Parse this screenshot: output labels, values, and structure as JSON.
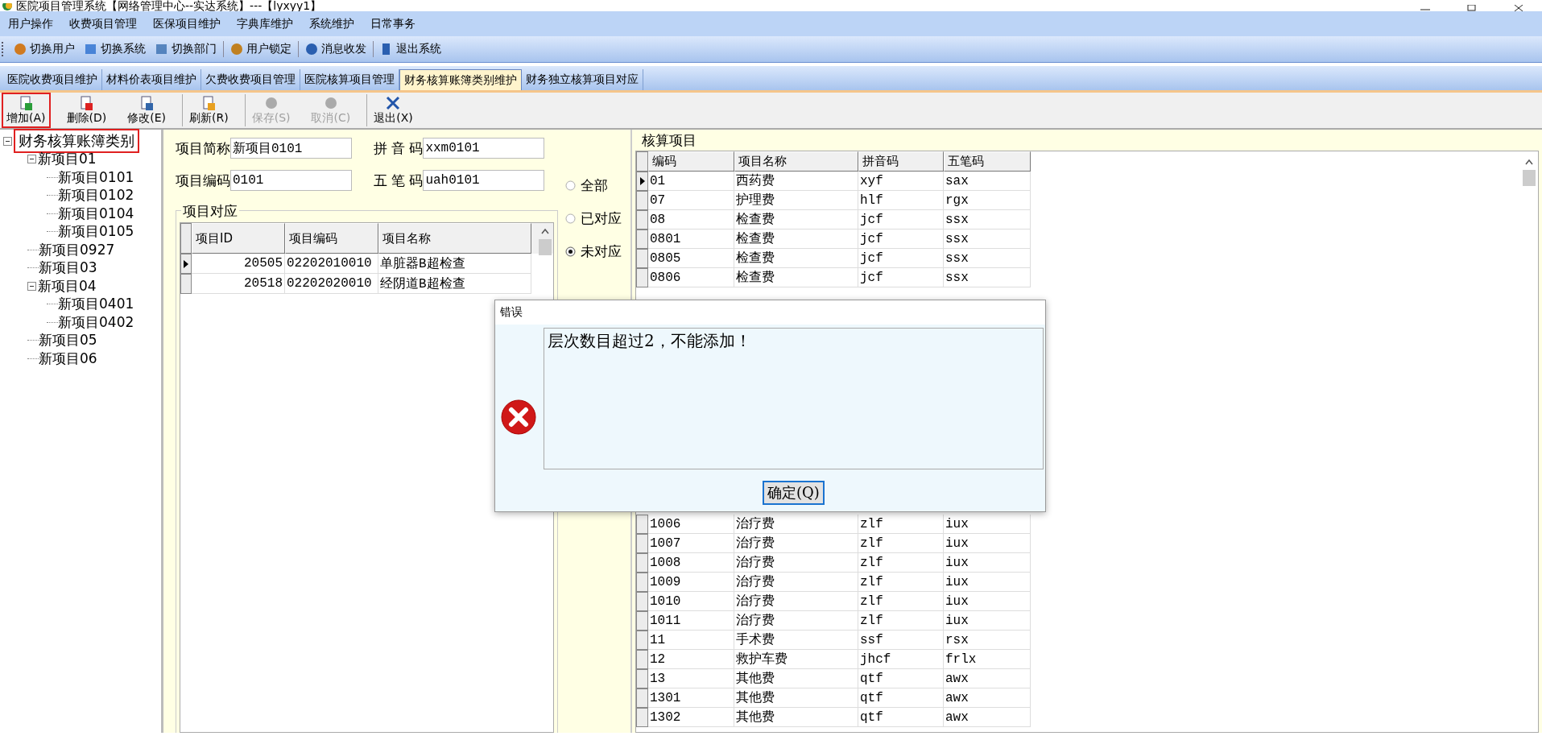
{
  "window": {
    "title": "医院项目管理系统【网络管理中心--实达系统】---【lyxyy1】"
  },
  "menu": [
    "用户操作",
    "收费项目管理",
    "医保项目维护",
    "字典库维护",
    "系统维护",
    "日常事务"
  ],
  "system_toolbar": [
    {
      "kind": "users",
      "label": "切换用户"
    },
    {
      "kind": "switch",
      "label": "切换系统"
    },
    {
      "kind": "calendar",
      "label": "切换部门"
    },
    {
      "kind": "lock",
      "label": "用户锁定"
    },
    {
      "kind": "info",
      "label": "消息收发"
    },
    {
      "kind": "exit",
      "label": "退出系统"
    }
  ],
  "tabs": [
    {
      "label": "医院收费项目维护",
      "selected": false
    },
    {
      "label": "材料价表项目维护",
      "selected": false
    },
    {
      "label": "欠费收费项目管理",
      "selected": false
    },
    {
      "label": "医院核算项目管理",
      "selected": false
    },
    {
      "label": "财务核算账簿类别维护",
      "selected": true
    },
    {
      "label": "财务独立核算项目对应",
      "selected": false
    }
  ],
  "actions": [
    {
      "kind": "add",
      "label": "增加(A)",
      "disabled": false,
      "highlighted": true
    },
    {
      "kind": "delete",
      "label": "删除(D)",
      "disabled": false,
      "highlighted": false
    },
    {
      "kind": "edit",
      "label": "修改(E)",
      "disabled": false,
      "highlighted": false
    },
    {
      "kind": "refresh",
      "label": "刷新(R)",
      "disabled": false,
      "highlighted": false
    },
    {
      "kind": "save",
      "label": "保存(S)",
      "disabled": true,
      "highlighted": false
    },
    {
      "kind": "cancel",
      "label": "取消(C)",
      "disabled": true,
      "highlighted": false
    },
    {
      "kind": "exit",
      "label": "退出(X)",
      "disabled": false,
      "highlighted": false
    }
  ],
  "tree": {
    "label": "财务核算账簿类别",
    "expanded": true,
    "highlighted": true,
    "children": [
      {
        "label": "新项目01",
        "expanded": true,
        "children": [
          {
            "label": "新项目0101"
          },
          {
            "label": "新项目0102"
          },
          {
            "label": "新项目0104"
          },
          {
            "label": "新项目0105"
          }
        ]
      },
      {
        "label": "新项目0927"
      },
      {
        "label": "新项目03"
      },
      {
        "label": "新项目04",
        "expanded": true,
        "children": [
          {
            "label": "新项目0401"
          },
          {
            "label": "新项目0402"
          }
        ]
      },
      {
        "label": "新项目05"
      },
      {
        "label": "新项目06"
      }
    ]
  },
  "form": {
    "fields": [
      {
        "label": "项目简称",
        "value": "新项目0101"
      },
      {
        "label": "拼 音 码",
        "value": "xxm0101"
      },
      {
        "label": "项目编码",
        "value": "0101"
      },
      {
        "label": "五 笔 码",
        "value": "uah0101"
      }
    ]
  },
  "filter": [
    {
      "label": "全部",
      "selected": false
    },
    {
      "label": "已对应",
      "selected": false
    },
    {
      "label": "未对应",
      "selected": true
    }
  ],
  "mapping": {
    "title": "项目对应",
    "columns": [
      "项目ID",
      "项目编码",
      "项目名称"
    ],
    "rows": [
      {
        "selected": true,
        "cells": [
          "20505",
          "02202010010",
          "单脏器B超检查"
        ]
      },
      {
        "selected": false,
        "cells": [
          "20518",
          "02202020010",
          "经阴道B超检查"
        ]
      }
    ]
  },
  "accounting": {
    "title": "核算项目",
    "columns": [
      "编码",
      "项目名称",
      "拼音码",
      "五笔码"
    ],
    "rows_top": [
      {
        "selected": true,
        "cells": [
          "01",
          "西药费",
          "xyf",
          "sax"
        ]
      },
      {
        "selected": false,
        "cells": [
          "07",
          "护理费",
          "hlf",
          "rgx"
        ]
      },
      {
        "selected": false,
        "cells": [
          "08",
          "检查费",
          "jcf",
          "ssx"
        ]
      },
      {
        "selected": false,
        "cells": [
          "0801",
          "检查费",
          "jcf",
          "ssx"
        ]
      },
      {
        "selected": false,
        "cells": [
          "0805",
          "检查费",
          "jcf",
          "ssx"
        ]
      },
      {
        "selected": false,
        "cells": [
          "0806",
          "检查费",
          "jcf",
          "ssx"
        ]
      }
    ],
    "rows_bottom": [
      {
        "selected": false,
        "cells": [
          "1006",
          "治疗费",
          "zlf",
          "iux"
        ]
      },
      {
        "selected": false,
        "cells": [
          "1007",
          "治疗费",
          "zlf",
          "iux"
        ]
      },
      {
        "selected": false,
        "cells": [
          "1008",
          "治疗费",
          "zlf",
          "iux"
        ]
      },
      {
        "selected": false,
        "cells": [
          "1009",
          "治疗费",
          "zlf",
          "iux"
        ]
      },
      {
        "selected": false,
        "cells": [
          "1010",
          "治疗费",
          "zlf",
          "iux"
        ]
      },
      {
        "selected": false,
        "cells": [
          "1011",
          "治疗费",
          "zlf",
          "iux"
        ]
      },
      {
        "selected": false,
        "cells": [
          "11",
          "手术费",
          "ssf",
          "rsx"
        ]
      },
      {
        "selected": false,
        "cells": [
          "12",
          "救护车费",
          "jhcf",
          "frlx"
        ]
      },
      {
        "selected": false,
        "cells": [
          "13",
          "其他费",
          "qtf",
          "awx"
        ]
      },
      {
        "selected": false,
        "cells": [
          "1301",
          "其他费",
          "qtf",
          "awx"
        ]
      },
      {
        "selected": false,
        "cells": [
          "1302",
          "其他费",
          "qtf",
          "awx"
        ]
      }
    ]
  },
  "dialog": {
    "title": "错误",
    "message": "层次数目超过2，不能添加！",
    "button": "确定(Q)"
  }
}
